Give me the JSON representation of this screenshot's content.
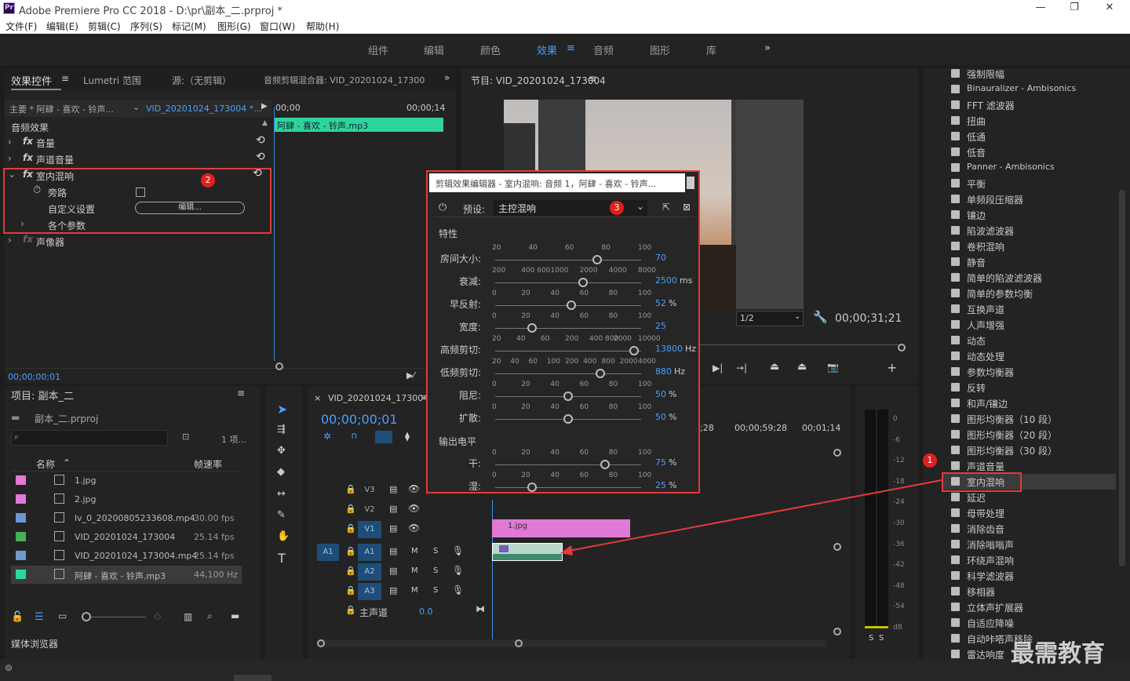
{
  "window": {
    "logo": "Pr",
    "title": "Adobe Premiere Pro CC 2018 - D:\\pr\\副本_二.prproj *",
    "minimize": "—",
    "restore": "❐",
    "close": "✕"
  },
  "menu": [
    "文件(F)",
    "编辑(E)",
    "剪辑(C)",
    "序列(S)",
    "标记(M)",
    "图形(G)",
    "窗口(W)",
    "帮助(H)"
  ],
  "workspaces": [
    "组件",
    "编辑",
    "颜色",
    "效果",
    "音频",
    "图形",
    "库"
  ],
  "workspace_active": "效果",
  "workspace_menu": "≡",
  "workspace_more": "»",
  "effect_controls": {
    "tabs": [
      "效果控件",
      "Lumetri 范围",
      "源:（无剪辑）",
      "音频剪辑混合器: VID_20201024_17300"
    ],
    "tab_menu": "≡",
    "more": "»",
    "source_label": "主要 * 阿肆 - 喜欢 - 铃声...",
    "clip_label": "VID_20201024_173004 *...",
    "time_start": "00;00",
    "time_end": "00;00;14",
    "clip_name": "阿肆 - 喜欢 - 铃声.mp3",
    "section": "音频效果",
    "rows": [
      "音量",
      "声道音量",
      "室内混响",
      "旁路",
      "自定义设置",
      "各个参数",
      "声像器"
    ],
    "fx": "fx",
    "edit_button": "编辑...",
    "timecode": "00;00;00;01"
  },
  "program": {
    "title": "节目: VID_20201024_173004",
    "menu": "≡",
    "zoom": "1/2",
    "timecode": "00;00;31;21",
    "plus": "+"
  },
  "dialog": {
    "title": "剪辑效果编辑器 - 室内混响: 音频 1，阿肆 - 喜欢 - 铃声...",
    "preset_label": "预设:",
    "preset_value": "主控混响",
    "section1": "特性",
    "section2": "输出电平",
    "params": [
      {
        "label": "房间大小:",
        "value": "70",
        "unit": "",
        "ticks": [
          "20",
          "40",
          "60",
          "80",
          "100"
        ],
        "fraction": 0.7
      },
      {
        "label": "衰减:",
        "value": "2500",
        "unit": "ms",
        "ticks": [
          "200",
          "400 600",
          "1000",
          "2000",
          "4000",
          "8000"
        ],
        "fraction": 0.6
      },
      {
        "label": "早反射:",
        "value": "52",
        "unit": "%",
        "ticks": [
          "0",
          "20",
          "40",
          "60",
          "80",
          "100"
        ],
        "fraction": 0.52
      },
      {
        "label": "宽度:",
        "value": "25",
        "unit": "",
        "ticks": [
          "0",
          "20",
          "40",
          "60",
          "80",
          "100"
        ],
        "fraction": 0.25
      },
      {
        "label": "高频剪切:",
        "value": "13800",
        "unit": "Hz",
        "ticks": [
          "20",
          "40",
          "60",
          "200",
          "400 800",
          "2000",
          "10000"
        ],
        "fraction": 0.95
      },
      {
        "label": "低频剪切:",
        "value": "880",
        "unit": "Hz",
        "ticks": [
          "20",
          "40",
          "60",
          "100",
          "200",
          "400",
          "800",
          "2000",
          "4000"
        ],
        "fraction": 0.72
      },
      {
        "label": "阻尼:",
        "value": "50",
        "unit": "%",
        "ticks": [
          "0",
          "20",
          "40",
          "60",
          "80",
          "100"
        ],
        "fraction": 0.5
      },
      {
        "label": "扩散:",
        "value": "50",
        "unit": "%",
        "ticks": [
          "0",
          "20",
          "40",
          "60",
          "80",
          "100"
        ],
        "fraction": 0.5
      },
      {
        "label": "干:",
        "value": "75",
        "unit": "%",
        "ticks": [
          "0",
          "20",
          "40",
          "60",
          "80",
          "100"
        ],
        "fraction": 0.75
      },
      {
        "label": "湿:",
        "value": "25",
        "unit": "%",
        "ticks": [
          "0",
          "20",
          "40",
          "60",
          "80",
          "100"
        ],
        "fraction": 0.25
      }
    ]
  },
  "badges": [
    "1",
    "2",
    "3"
  ],
  "project": {
    "title": "项目: 副本_二",
    "menu": "≡",
    "file": "副本_二.prproj",
    "count": "1 项...",
    "col_name": "名称",
    "col_rate": "帧速率",
    "items": [
      {
        "name": "1.jpg",
        "rate": "",
        "color": "#e07ad6"
      },
      {
        "name": "2.jpg",
        "rate": "",
        "color": "#e07ad6"
      },
      {
        "name": "lv_0_20200805233608.mp4",
        "rate": "30.00 fps",
        "color": "#6e98cf"
      },
      {
        "name": "VID_20201024_173004",
        "rate": "25.14 fps",
        "color": "#43b356"
      },
      {
        "name": "VID_20201024_173004.mp4",
        "rate": "25.14 fps",
        "color": "#6e98cf"
      },
      {
        "name": "阿肆 - 喜欢 - 铃声.mp3",
        "rate": "44,100 Hz",
        "color": "#2fd6a0"
      }
    ],
    "media_browser": "媒体浏览器"
  },
  "timeline": {
    "title": "VID_20201024_173004",
    "close": "×",
    "menu": "≡",
    "timecode": "00;00;00;01",
    "ruler": [
      ";28",
      "00;00;59;28",
      "00;01;14"
    ],
    "tracks": [
      "V3",
      "V2",
      "V1",
      "A1",
      "A2",
      "A3"
    ],
    "src_a1": "A1",
    "master": "主声道",
    "master_val": "0.0",
    "clip_v1": "1.jpg",
    "m": "M",
    "s": "S"
  },
  "meter": {
    "labels": [
      "0",
      "-6",
      "-12",
      "-18",
      "-24",
      "-30",
      "-36",
      "-42",
      "-48",
      "-54",
      "dB"
    ],
    "solo": "S"
  },
  "effects_list": [
    "强制限幅",
    "Binauralizer - Ambisonics",
    "FFT 滤波器",
    "扭曲",
    "低通",
    "低音",
    "Panner - Ambisonics",
    "平衡",
    "单频段压缩器",
    "镶边",
    "陷波滤波器",
    "卷积混响",
    "静音",
    "简单的陷波滤波器",
    "简单的参数均衡",
    "互换声道",
    "人声增强",
    "动态",
    "动态处理",
    "参数均衡器",
    "反转",
    "和声/镶边",
    "图形均衡器（10 段）",
    "图形均衡器（20 段）",
    "图形均衡器（30 段）",
    "声道音量",
    "室内混响",
    "延迟",
    "母带处理",
    "消除齿音",
    "消除嗡嗡声",
    "环绕声混响",
    "科学滤波器",
    "移相器",
    "立体声扩展器",
    "自适应降噪",
    "自动咔嗒声移除",
    "雷达响度"
  ],
  "effects_selected": "室内混响",
  "watermark": "最需教育"
}
